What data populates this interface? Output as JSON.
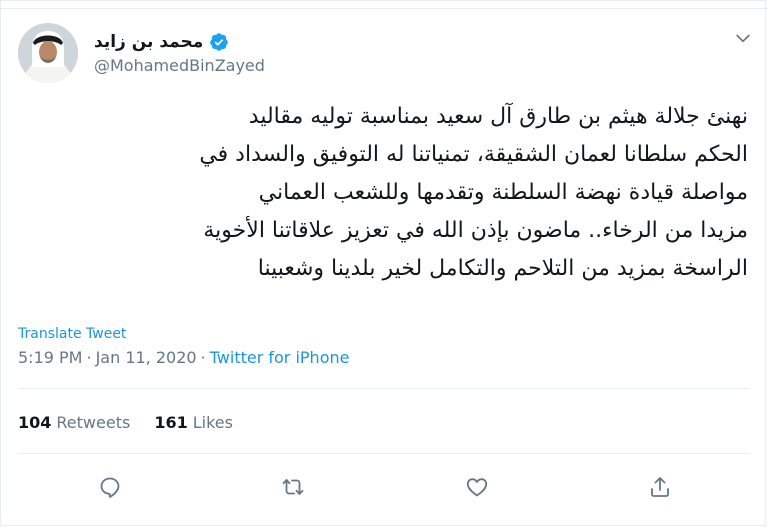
{
  "user": {
    "display_name": "محمد بن زايد",
    "handle": "@MohamedBinZayed",
    "verified": true
  },
  "tweet": {
    "lines": [
      "نهنئ جلالة هيثم بن طارق آل سعيد بمناسبة توليه مقاليد",
      "الحكم سلطانا لعمان الشقيقة، تمنياتنا له التوفيق والسداد في",
      "مواصلة قيادة نهضة السلطنة وتقدمها وللشعب العماني",
      "مزيدا من الرخاء.. ماضون بإذن الله في تعزيز علاقاتنا الأخوية",
      "الراسخة بمزيد من التلاحم والتكامل لخير بلدينا وشعبينا"
    ],
    "translate_label": "Translate Tweet",
    "time": "5:19 PM",
    "separator": "·",
    "date": "Jan 11, 2020",
    "source": "Twitter for iPhone"
  },
  "stats": {
    "retweets_count": "104",
    "retweets_label": "Retweets",
    "likes_count": "161",
    "likes_label": "Likes"
  },
  "icons": {
    "verified": "verified-badge-icon",
    "more": "chevron-down-icon",
    "reply": "reply-icon",
    "retweet": "retweet-icon",
    "like": "heart-icon",
    "share": "share-icon"
  },
  "colors": {
    "accent": "#1da1f2",
    "link": "#1b95e0",
    "muted": "#657786",
    "text": "#14171a",
    "border": "#e6ecf0"
  }
}
